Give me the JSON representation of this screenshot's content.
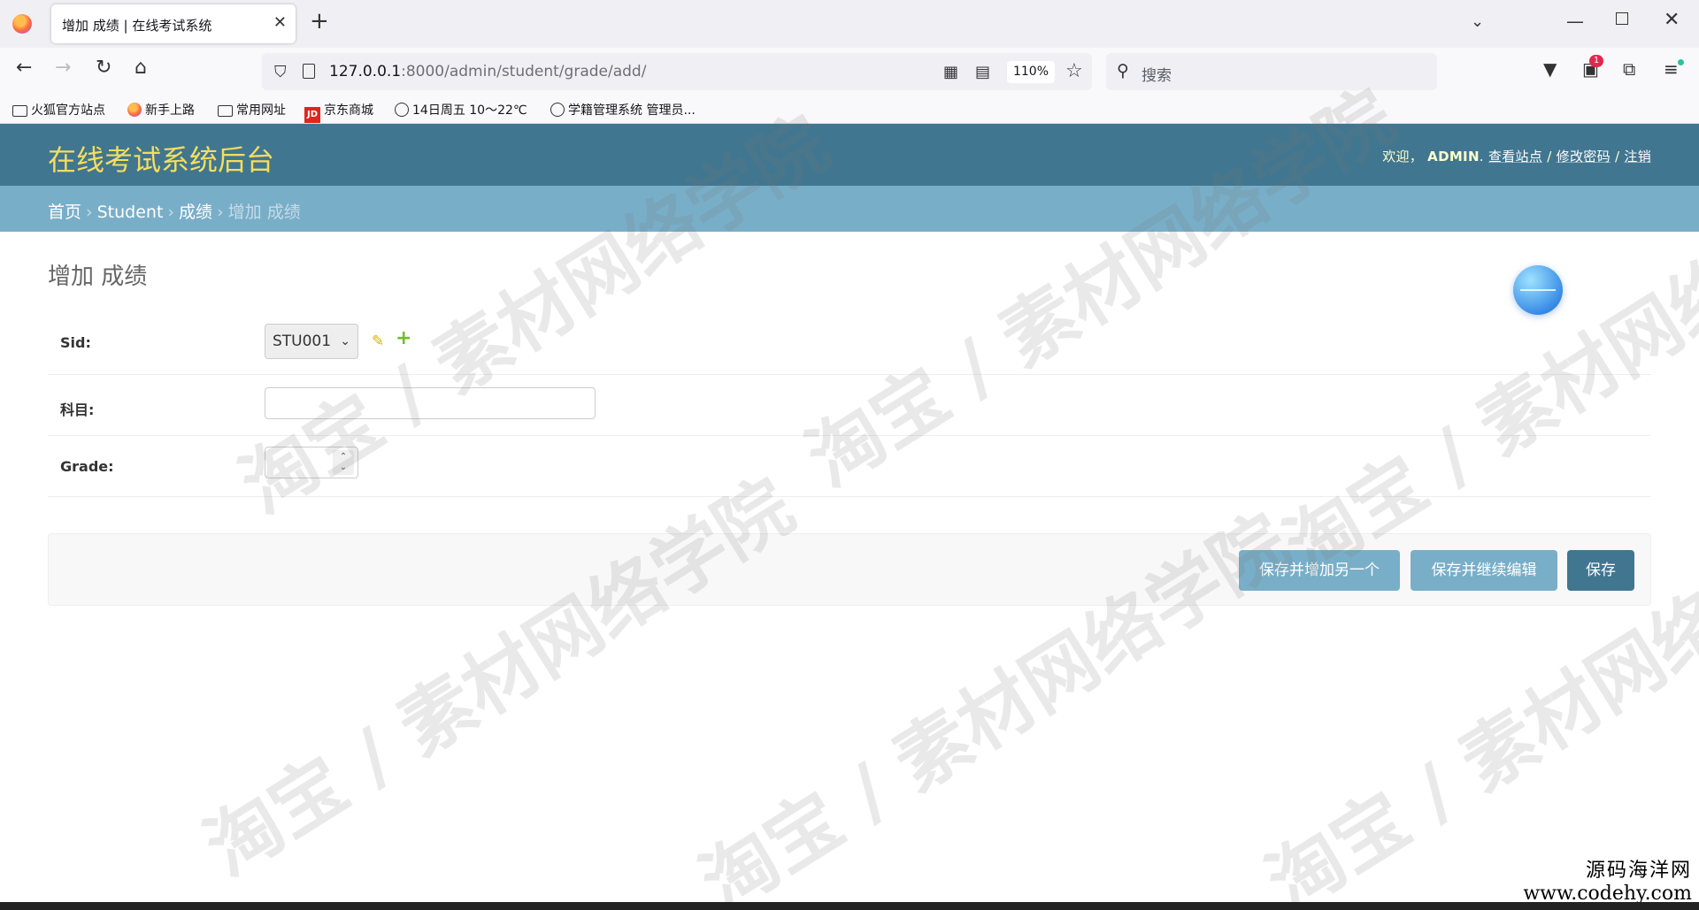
{
  "browser": {
    "tab_title": "增加 成绩 | 在线考试系统",
    "tab_close": "✕",
    "new_tab": "+",
    "url_host": "127.0.0.1",
    "url_rest": ":8000/admin/student/grade/add/",
    "zoom": "110%",
    "search_placeholder": "搜索",
    "notification_badge": "1",
    "bookmarks": [
      {
        "label": "火狐官方站点",
        "icon": "folder-icon"
      },
      {
        "label": "新手上路",
        "icon": "firefox-icon"
      },
      {
        "label": "常用网址",
        "icon": "folder-icon"
      },
      {
        "label": "京东商城",
        "icon": "jd-icon"
      },
      {
        "label": "14日周五  10～22℃",
        "icon": "globe-icon"
      },
      {
        "label": "学籍管理系统 管理员...",
        "icon": "globe-icon"
      }
    ],
    "jd_badge": "JD"
  },
  "admin": {
    "branding": "在线考试系统后台",
    "welcome": "欢迎，",
    "username": "ADMIN",
    "period": ".",
    "view_site": "查看站点",
    "change_password": "修改密码",
    "logout": "注销",
    "separator": "/",
    "breadcrumbs": {
      "home": "首页",
      "app": "Student",
      "model": "成绩",
      "current": "增加 成绩",
      "arrow": "›"
    },
    "page_title": "增加 成绩"
  },
  "form": {
    "sid_label": "Sid:",
    "sid_value": "STU001",
    "subject_label": "科目:",
    "subject_value": "",
    "grade_label": "Grade:",
    "grade_value": ""
  },
  "buttons": {
    "save_add_another": "保存并增加另一个",
    "save_continue": "保存并继续编辑",
    "save": "保存"
  },
  "watermark": {
    "text": "淘宝 / 素材网络学院"
  },
  "corner_mark": {
    "line1": "源码海洋网",
    "line2": "www.codehy.com"
  },
  "colors": {
    "header_bg": "#417690",
    "breadcrumb_bg": "#79aec8",
    "branding": "#f5dd5d",
    "button_light": "#79aec8",
    "button_dark": "#417690"
  }
}
